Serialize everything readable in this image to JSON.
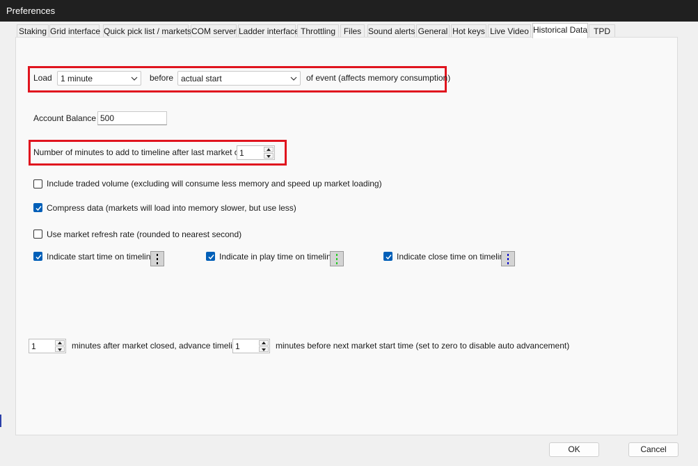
{
  "window": {
    "title": "Preferences"
  },
  "tabs": [
    {
      "label": "Staking"
    },
    {
      "label": "Grid interface"
    },
    {
      "label": "Quick pick list / markets"
    },
    {
      "label": "COM server"
    },
    {
      "label": "Ladder interface"
    },
    {
      "label": "Throttling"
    },
    {
      "label": "Files"
    },
    {
      "label": "Sound alerts"
    },
    {
      "label": "General"
    },
    {
      "label": "Hot keys"
    },
    {
      "label": "Live Video"
    },
    {
      "label": "Historical Data",
      "active": true
    },
    {
      "label": "TPD"
    }
  ],
  "load_row": {
    "load_label": "Load",
    "duration_value": "1 minute",
    "before_label": "before",
    "reference_value": "actual start",
    "suffix_label": "of event (affects memory consumption)"
  },
  "account_balance": {
    "label": "Account Balance",
    "value": "500"
  },
  "minutes_after_close": {
    "label": "Number of minutes to add to timeline after last market closed",
    "value": "1"
  },
  "options": {
    "include_traded_volume": {
      "label": "Include traded volume (excluding will consume less memory and speed up market loading)",
      "checked": false
    },
    "compress_data": {
      "label": "Compress data (markets will load into memory slower, but use less)",
      "checked": true
    },
    "use_refresh_rate": {
      "label": "Use market refresh rate (rounded to nearest second)",
      "checked": false
    }
  },
  "indicators": {
    "start_time": {
      "label": "Indicate start time on timeline",
      "checked": true,
      "color": "#000000"
    },
    "in_play_time": {
      "label": "Indicate in play time on timeline",
      "checked": true,
      "color": "#22cc22"
    },
    "close_time": {
      "label": "Indicate close time on timeline",
      "checked": true,
      "color": "#0000cc"
    }
  },
  "advance_row": {
    "minutes_after_value": "1",
    "middle_label": "minutes after market closed, advance timeline to",
    "minutes_before_value": "1",
    "suffix_label": "minutes before next market start time (set to zero to disable auto advancement)"
  },
  "buttons": {
    "ok": "OK",
    "cancel": "Cancel"
  },
  "colors": {
    "highlight": "#e0141e",
    "check_accent": "#005fb8",
    "titlebar": "#202020"
  }
}
